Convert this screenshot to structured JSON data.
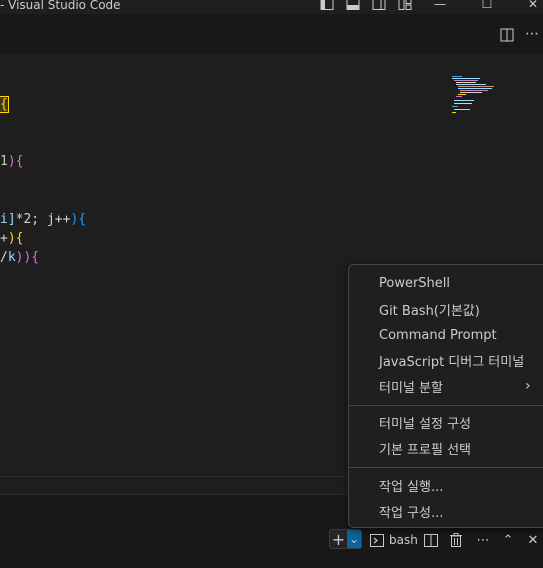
{
  "window": {
    "title": "- Visual Studio Code",
    "icons": [
      "toggle-primary-sidebar-icon",
      "toggle-panel-icon",
      "toggle-secondary-sidebar-icon",
      "customize-layout-icon"
    ],
    "minimize": "—",
    "maximize": "☐",
    "close": "✕"
  },
  "editor_actions": {
    "split": "split-editor-icon",
    "more": "⋯"
  },
  "code": {
    "line1": "{",
    "line2_a": "1",
    "line2_b": "){",
    "line3_a": "i]",
    "line3_b": "*2; j++",
    "line3_c": "){",
    "line4_a": "+",
    "line4_b": "){",
    "line5_a": "/",
    "line5_b": "k",
    "line5_c": ")){"
  },
  "terminal_menu": {
    "items": [
      {
        "label": "PowerShell"
      },
      {
        "label": "Git Bash(기본값)"
      },
      {
        "label": "Command Prompt"
      },
      {
        "label": "JavaScript 디버그 터미널"
      },
      {
        "label": "터미널 분할",
        "submenu": true
      }
    ],
    "items2": [
      {
        "label": "터미널 설정 구성"
      },
      {
        "label": "기본 프로필 선택"
      }
    ],
    "items3": [
      {
        "label": "작업 실행..."
      },
      {
        "label": "작업 구성..."
      }
    ],
    "submenu_arrow": "›"
  },
  "terminal_toolbar": {
    "new_terminal": "+",
    "dropdown": "⌄",
    "terminal_name": "bash",
    "more": "⋯",
    "maximize": "⌃",
    "close": "✕"
  },
  "colors": {
    "bracket_yellow": "#ffd700",
    "bracket_pink": "#da70d6",
    "bracket_blue": "#179fff",
    "number": "#b5cea8",
    "variable": "#9cdcfe",
    "text": "#d4d4d4"
  }
}
